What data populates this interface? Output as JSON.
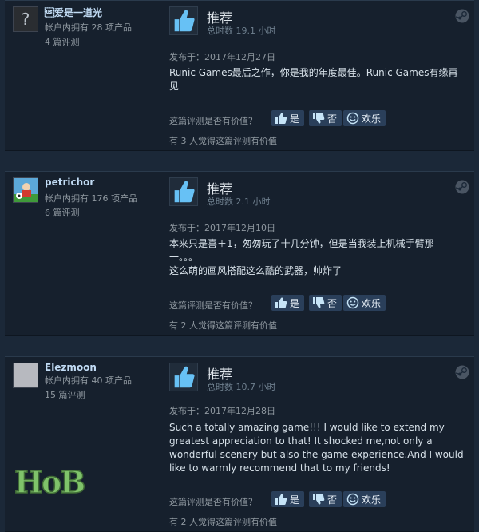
{
  "reviews": [
    {
      "user_name": "\u001f爱是一道光",
      "products_owned": "帐户内拥有 28 项产品",
      "review_count": "4 篇评测",
      "verdict": "推荐",
      "hours": "总时数 19.1 小时",
      "posted": "发布于：2017年12月27日",
      "content": "Runic Games最后之作，你是我的年度最佳。Runic Games有缘再见",
      "helpful_question": "这篇评测是否有价值？",
      "yes_label": "是",
      "no_label": "否",
      "funny_label": "欢乐",
      "helpful_count": "有 3 人觉得这篇评测有价值"
    },
    {
      "user_name": "petrichor",
      "products_owned": "帐户内拥有 176 项产品",
      "review_count": "6 篇评测",
      "verdict": "推荐",
      "hours": "总时数 2.1 小时",
      "posted": "发布于：2017年12月10日",
      "content_line1": "本来只是喜＋1，匆匆玩了十几分钟，但是当我装上机械手臂那",
      "content_line2": "一。。。",
      "content_line3": "这么萌的画风搭配这么酷的武器，帅炸了",
      "helpful_question": "这篇评测是否有价值？",
      "yes_label": "是",
      "no_label": "否",
      "funny_label": "欢乐",
      "helpful_count": "有 2 人觉得这篇评测有价值"
    },
    {
      "user_name": "Elezmoon",
      "products_owned": "帐户内拥有 40 项产品",
      "review_count": "15 篇评测",
      "verdict": "推荐",
      "hours": "总时数 10.7 小时",
      "posted": "发布于：2017年12月28日",
      "content": "Such a totally amazing game!!! I would like to extend my greatest appreciation to that! It shocked me,not only a wonderful scenery but also the game experience.And I would like to warmly recommend that to my friends!",
      "helpful_question": "这篇评测是否有价值？",
      "yes_label": "是",
      "no_label": "否",
      "funny_label": "欢乐",
      "helpful_count": "有 2 人觉得这篇评测有价值"
    }
  ],
  "watermark": {
    "logo_text": "HoB",
    "color": "#7fc36a"
  },
  "colors": {
    "background": "#1b2838",
    "panel": "#16202d",
    "accent": "#67c1f5",
    "button": "#2a3f5a"
  }
}
